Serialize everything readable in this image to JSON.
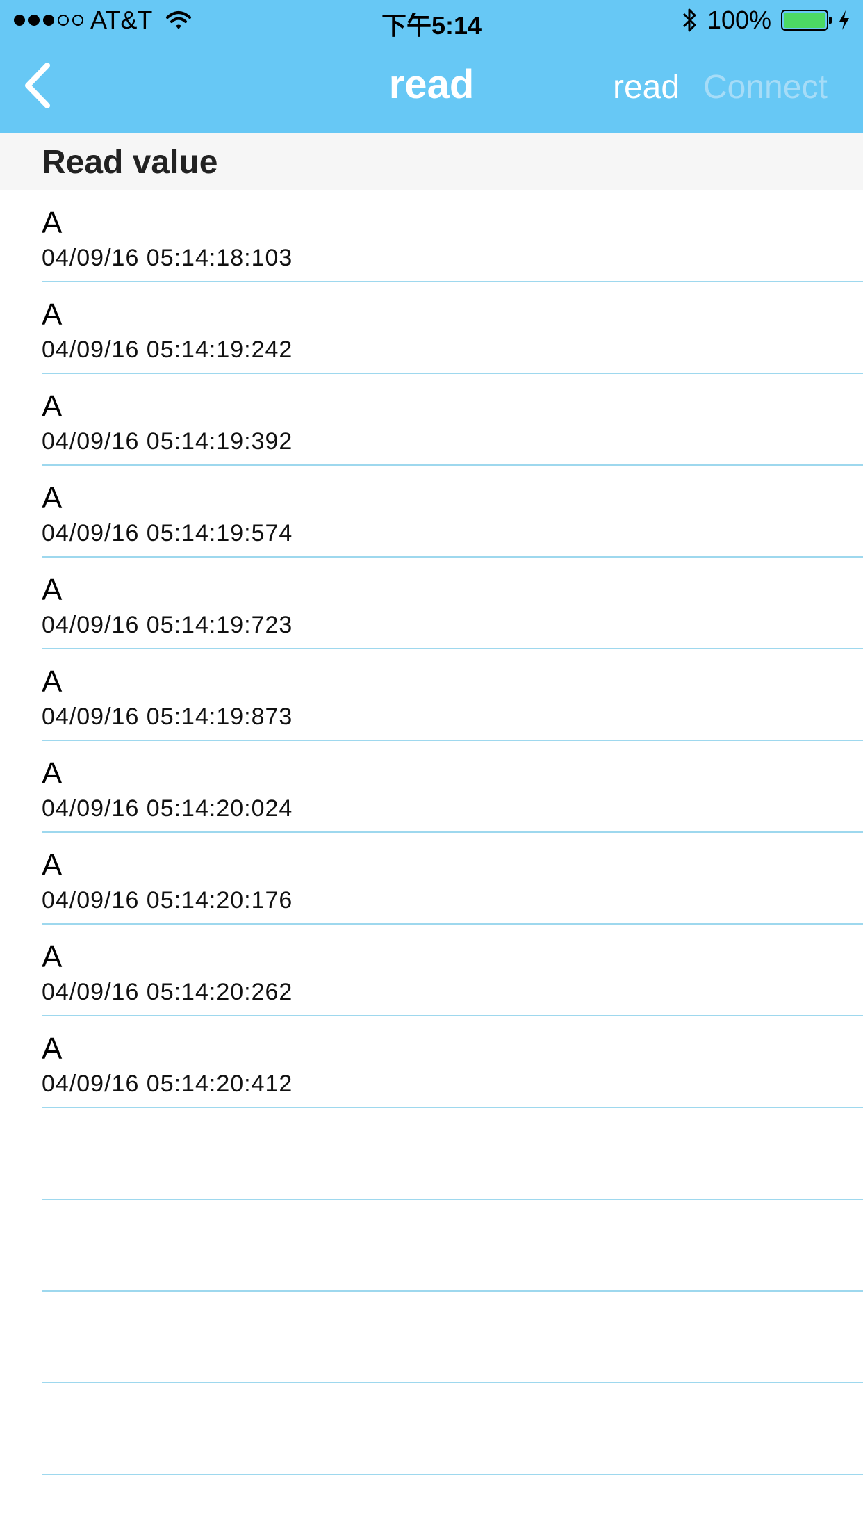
{
  "status_bar": {
    "carrier": "AT&T",
    "signal_dots": [
      true,
      true,
      true,
      false,
      false
    ],
    "time": "下午5:14",
    "battery": "100%",
    "icons": [
      "wifi-icon",
      "bluetooth-icon",
      "battery-icon",
      "charging-bolt-icon"
    ]
  },
  "nav": {
    "back_icon": "chevron-left-icon",
    "title": "read",
    "read_label": "read",
    "connect_label": "Connect",
    "bar_color": "#67c8f5"
  },
  "section": {
    "title": "Read value"
  },
  "rows": [
    {
      "value": "A",
      "time": "04/09/16 05:14:18:103"
    },
    {
      "value": "A",
      "time": "04/09/16 05:14:19:242"
    },
    {
      "value": "A",
      "time": "04/09/16 05:14:19:392"
    },
    {
      "value": "A",
      "time": "04/09/16 05:14:19:574"
    },
    {
      "value": "A",
      "time": "04/09/16 05:14:19:723"
    },
    {
      "value": "A",
      "time": "04/09/16 05:14:19:873"
    },
    {
      "value": "A",
      "time": "04/09/16 05:14:20:024"
    },
    {
      "value": "A",
      "time": "04/09/16 05:14:20:176"
    },
    {
      "value": "A",
      "time": "04/09/16 05:14:20:262"
    },
    {
      "value": "A",
      "time": "04/09/16 05:14:20:412"
    },
    {
      "value": "",
      "time": ""
    },
    {
      "value": "",
      "time": ""
    },
    {
      "value": "",
      "time": ""
    },
    {
      "value": "",
      "time": ""
    }
  ]
}
